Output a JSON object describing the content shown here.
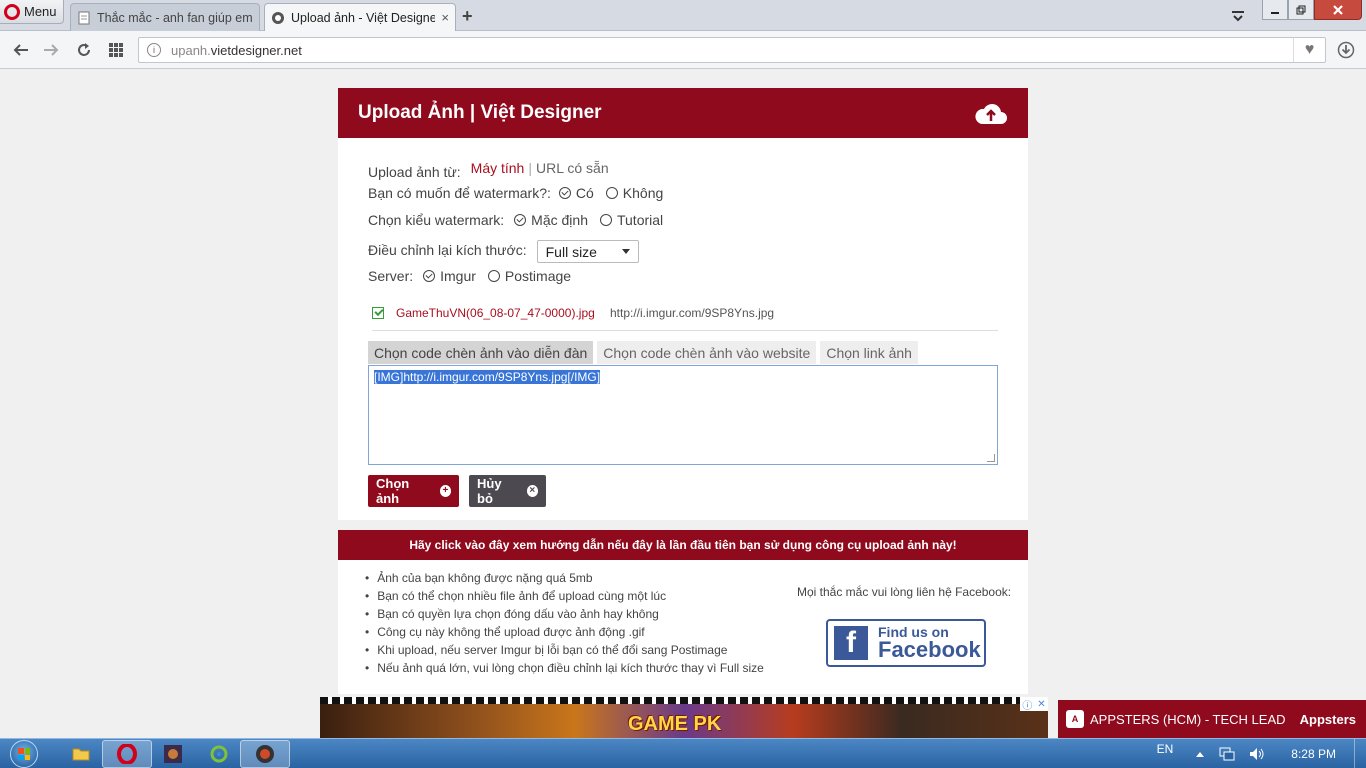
{
  "browser": {
    "menu_label": "Menu",
    "tabs": [
      {
        "title": "Thắc mắc - anh fan giúp em",
        "icon": "document-icon"
      },
      {
        "title": "Upload ảnh - Việt Designer",
        "icon": "vd-icon",
        "close": "×"
      }
    ],
    "new_tab": "+",
    "url_host": "upanh.",
    "url_domain": "vietdesigner.net"
  },
  "page": {
    "title": "Upload Ảnh | Việt Designer",
    "upload_from_label": "Upload ảnh từ:",
    "source_computer": "Máy tính",
    "source_sep": "|",
    "source_url": "URL có sẵn",
    "watermark_question": "Bạn có muốn để watermark?:",
    "watermark_yes": "Có",
    "watermark_no": "Không",
    "watermark_type_label": "Chọn kiểu watermark:",
    "watermark_default": "Mặc định",
    "watermark_tutorial": "Tutorial",
    "resize_label": "Điều chỉnh lại kích thước:",
    "resize_value": "Full size",
    "server_label": "Server:",
    "server_imgur": "Imgur",
    "server_postimage": "Postimage",
    "file_name": "GameThuVN(06_08-07_47-0000).jpg",
    "file_url": "http://i.imgur.com/9SP8Yns.jpg",
    "code_tabs": [
      "Chọn code chèn ảnh vào diễn đàn",
      "Chọn code chèn ảnh vào website",
      "Chọn link ảnh"
    ],
    "code_value": "[IMG]http://i.imgur.com/9SP8Yns.jpg[/IMG]",
    "choose_button": "Chọn ảnh",
    "cancel_button": "Hủy bỏ"
  },
  "info": {
    "banner_pre": "Hãy click ",
    "banner_link": "vào đây",
    "banner_post": " xem hướng dẫn nếu đây là lần đầu tiên bạn sử dụng công cụ upload ảnh này!",
    "tips": [
      "Ảnh của bạn không được nặng quá 5mb",
      "Bạn có thể chọn nhiều file ảnh để upload cùng một lúc",
      "Bạn có quyền lựa chọn đóng dấu vào ảnh hay không",
      "Công cụ này không thể upload được ảnh động .gif",
      "Khi upload, nếu server Imgur bị lỗi bạn có thể đổi sang Postimage",
      "Nếu ảnh quá lớn, vui lòng chọn điều chỉnh lại kích thước thay vì Full size"
    ],
    "contact": "Mọi thắc mắc vui lòng liên hệ Facebook:",
    "fb_find": "Find us on",
    "fb_name": "Facebook",
    "fb_letter": "f"
  },
  "ads": {
    "banner_text": "GAME PK",
    "side_text": "APPSTERS (HCM) - TECH LEAD",
    "side_brand": "Appsters"
  },
  "taskbar": {
    "lang": "EN",
    "time": "8:28 PM"
  },
  "colors": {
    "brand": "#8e0a1c",
    "cancel": "#4d4950",
    "facebook": "#3b5998"
  }
}
